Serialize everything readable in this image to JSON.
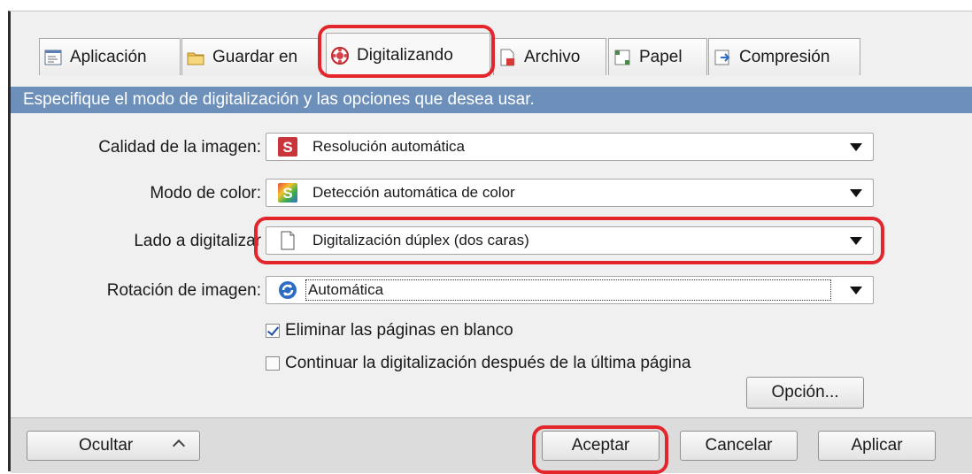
{
  "tabs": [
    {
      "label": "Aplicación",
      "icon": "application-icon"
    },
    {
      "label": "Guardar en",
      "icon": "folder-icon"
    },
    {
      "label": "Digitalizando",
      "icon": "scan-icon",
      "active": true
    },
    {
      "label": "Archivo",
      "icon": "file-icon"
    },
    {
      "label": "Papel",
      "icon": "paper-icon"
    },
    {
      "label": "Compresión",
      "icon": "compression-icon"
    }
  ],
  "description": "Especifique el modo de digitalización y las opciones que desea usar.",
  "settings": {
    "image_quality": {
      "label": "Calidad de la imagen:",
      "value": "Resolución automática",
      "icon": "scansnap-red-icon"
    },
    "color_mode": {
      "label": "Modo de color:",
      "value": "Detección automática de color",
      "icon": "scansnap-color-icon"
    },
    "scan_side": {
      "label": "Lado a digitalizar",
      "value": "Digitalización dúplex (dos caras)",
      "icon": "duplex-page-icon"
    },
    "rotation": {
      "label": "Rotación de imagen:",
      "value": "Automática",
      "icon": "rotate-icon"
    }
  },
  "checkboxes": {
    "remove_blank": {
      "label": "Eliminar las páginas en blanco",
      "checked": true
    },
    "continue_scan": {
      "label": "Continuar la digitalización después de la última página",
      "checked": false
    }
  },
  "buttons": {
    "option": "Opción...",
    "hide": "Ocultar",
    "accept": "Aceptar",
    "cancel": "Cancelar",
    "apply": "Aplicar"
  },
  "colors": {
    "highlight": "#e3262b",
    "description_bar": "#6d90ba"
  }
}
